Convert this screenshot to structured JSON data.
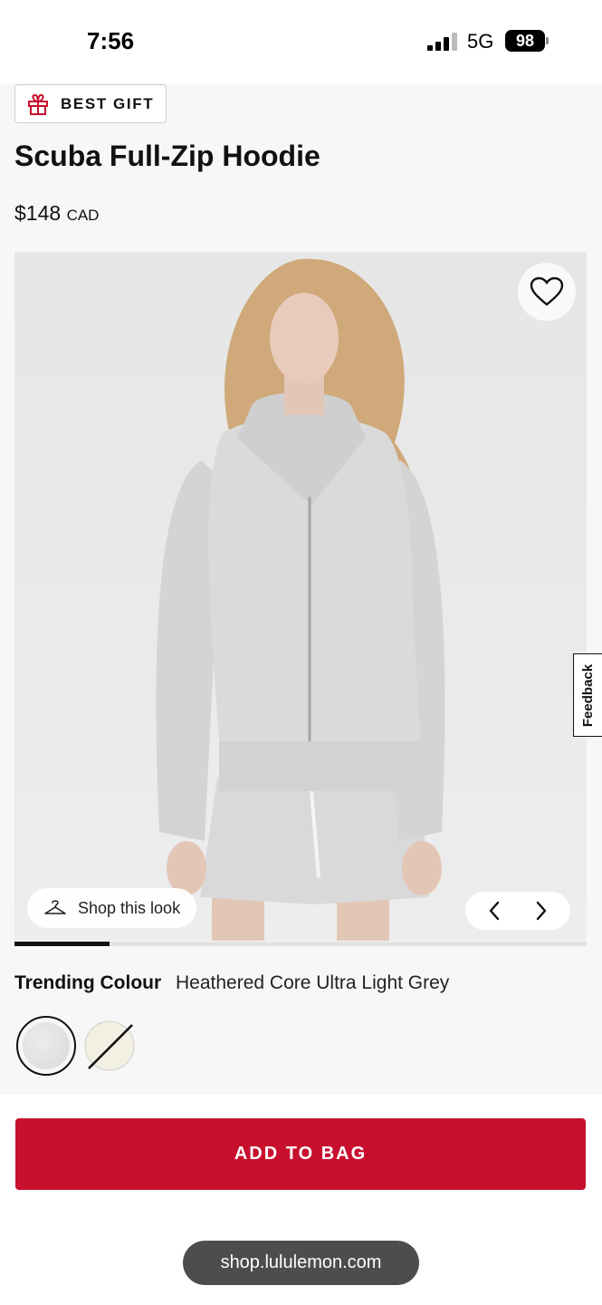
{
  "status_bar": {
    "time": "7:56",
    "network": "5G",
    "battery": "98"
  },
  "product": {
    "badge": {
      "label": "BEST GIFT",
      "icon": "gift-icon"
    },
    "title": "Scuba Full-Zip Hoodie",
    "price": {
      "amount": "$148",
      "currency": "CAD"
    },
    "gallery": {
      "shop_look_label": "Shop this look",
      "shop_look_icon": "hanger-icon",
      "wishlist_icon": "heart-icon",
      "progress_fraction": 0.166,
      "prev_icon": "chevron-left-icon",
      "next_icon": "chevron-right-icon"
    },
    "colour": {
      "label": "Trending Colour",
      "value": "Heathered Core Ultra Light Grey",
      "swatches": [
        {
          "name": "Heathered Core Ultra Light Grey",
          "selected": true,
          "color": "#e1e1e1",
          "available": true
        },
        {
          "name": "Cream",
          "selected": false,
          "color": "#f1f0e2",
          "available": false
        }
      ]
    }
  },
  "feedback_label": "Feedback",
  "add_to_bag_label": "ADD TO BAG",
  "url": "shop.lululemon.com",
  "colors": {
    "accent": "#c8102e",
    "dark": "#111111"
  }
}
